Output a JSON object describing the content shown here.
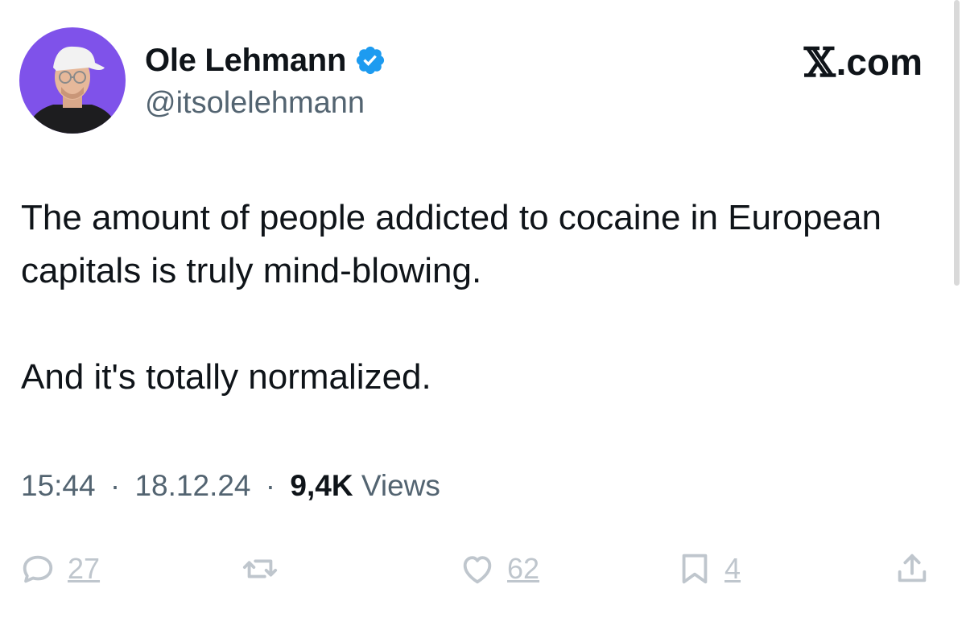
{
  "author": {
    "display_name": "Ole Lehmann",
    "handle": "@itsolelehmann",
    "verified": true,
    "verified_color": "#1d9bf0",
    "avatar_background": "#7f52ea"
  },
  "brand": {
    "x_glyph": "𝕏",
    "domain": ".com"
  },
  "tweet": {
    "paragraph_1": "The amount of people addicted to cocaine in European capitals is truly mind-blowing.",
    "paragraph_2": "And it's totally normalized."
  },
  "meta": {
    "time": "15:44",
    "separator": "·",
    "date": "18.12.24",
    "views_count": "9,4K",
    "views_label": "Views"
  },
  "actions": {
    "replies": "27",
    "retweets": "",
    "likes": "62",
    "bookmarks": "4"
  },
  "icons": {
    "reply": "reply-icon",
    "retweet": "retweet-icon",
    "like": "heart-icon",
    "bookmark": "bookmark-icon",
    "share": "share-icon"
  }
}
